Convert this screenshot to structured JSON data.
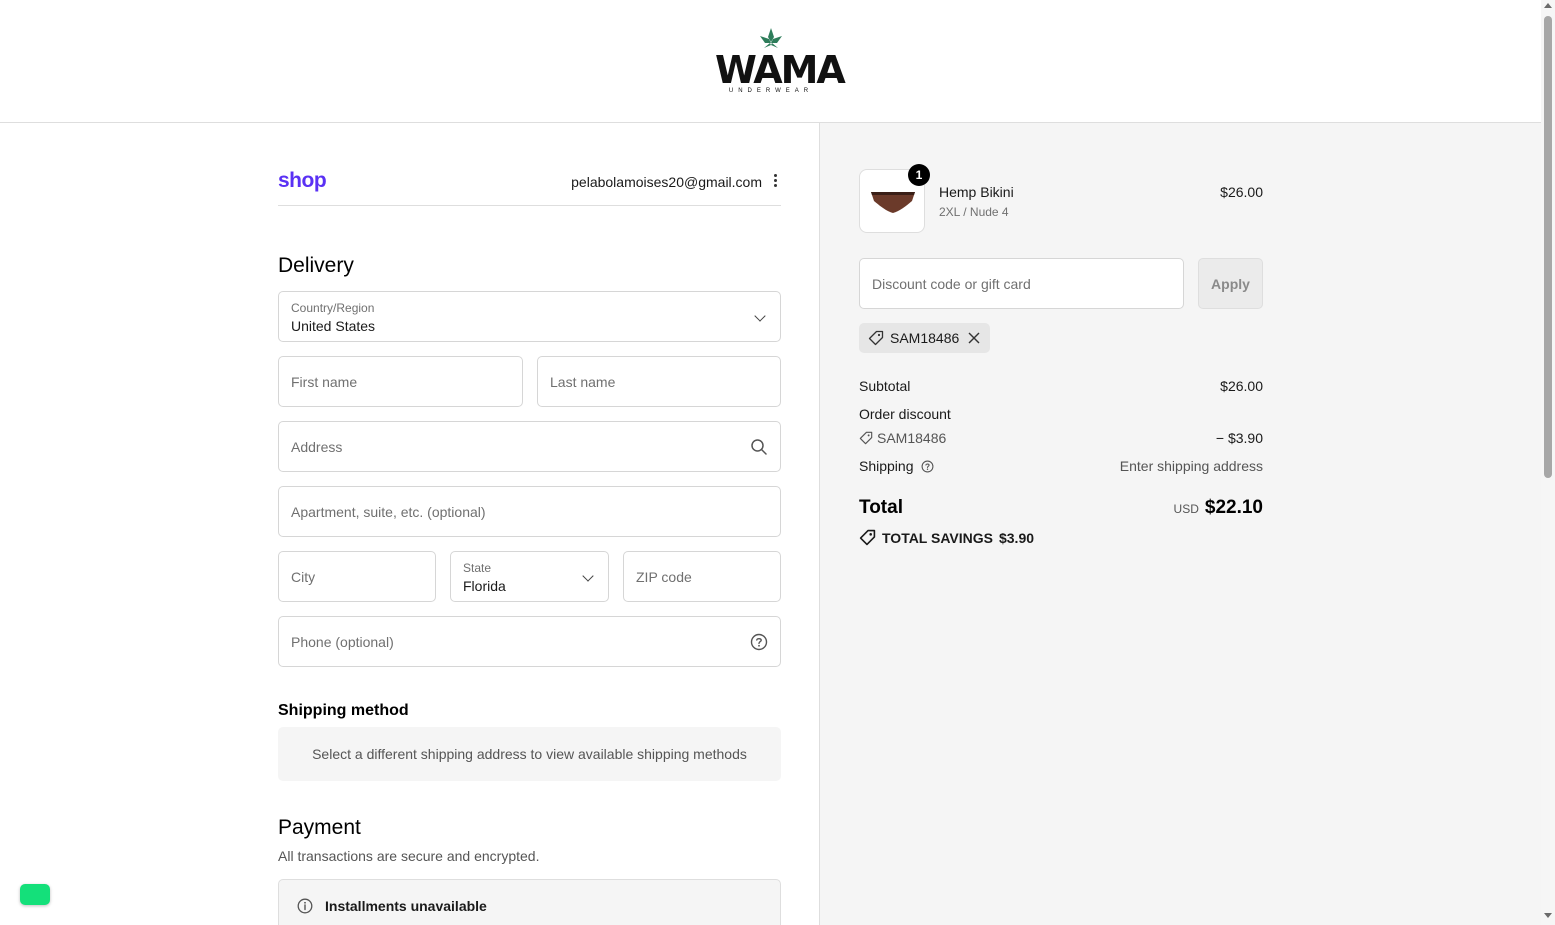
{
  "header": {
    "logo_text": "WAMA",
    "logo_subtext": "UNDERWEAR"
  },
  "shop": {
    "brand": "shop",
    "email": "pelabolamoises20@gmail.com"
  },
  "delivery": {
    "title": "Delivery",
    "country_label": "Country/Region",
    "country_value": "United States",
    "first_name_placeholder": "First name",
    "last_name_placeholder": "Last name",
    "address_placeholder": "Address",
    "apartment_placeholder": "Apartment, suite, etc. (optional)",
    "city_placeholder": "City",
    "state_label": "State",
    "state_value": "Florida",
    "zip_placeholder": "ZIP code",
    "phone_placeholder": "Phone (optional)"
  },
  "shipping_method": {
    "title": "Shipping method",
    "message": "Select a different shipping address to view available shipping methods"
  },
  "payment": {
    "title": "Payment",
    "subtitle": "All transactions are secure and encrypted.",
    "installments": "Installments unavailable"
  },
  "summary": {
    "product": {
      "name": "Hemp Bikini",
      "variant": "2XL / Nude 4",
      "price": "$26.00",
      "quantity": "1"
    },
    "discount_placeholder": "Discount code or gift card",
    "apply_label": "Apply",
    "applied_code": "SAM18486",
    "subtotal_label": "Subtotal",
    "subtotal_value": "$26.00",
    "order_discount_label": "Order discount",
    "discount_code": "SAM18486",
    "discount_value": "− $3.90",
    "shipping_label": "Shipping",
    "shipping_value": "Enter shipping address",
    "total_label": "Total",
    "total_currency": "USD",
    "total_value": "$22.10",
    "savings_label": "TOTAL SAVINGS",
    "savings_value": "$3.90"
  },
  "colors": {
    "shop_brand": "#5a31f4",
    "logo_leaf": "#2e7d5b",
    "chat_button": "#14e07a",
    "summary_bg": "#f5f5f5"
  },
  "icons": [
    "chevron-down-icon",
    "search-icon",
    "help-circle-icon",
    "tag-icon",
    "close-icon",
    "info-icon",
    "kebab-menu-icon",
    "leaf-logo-icon"
  ]
}
